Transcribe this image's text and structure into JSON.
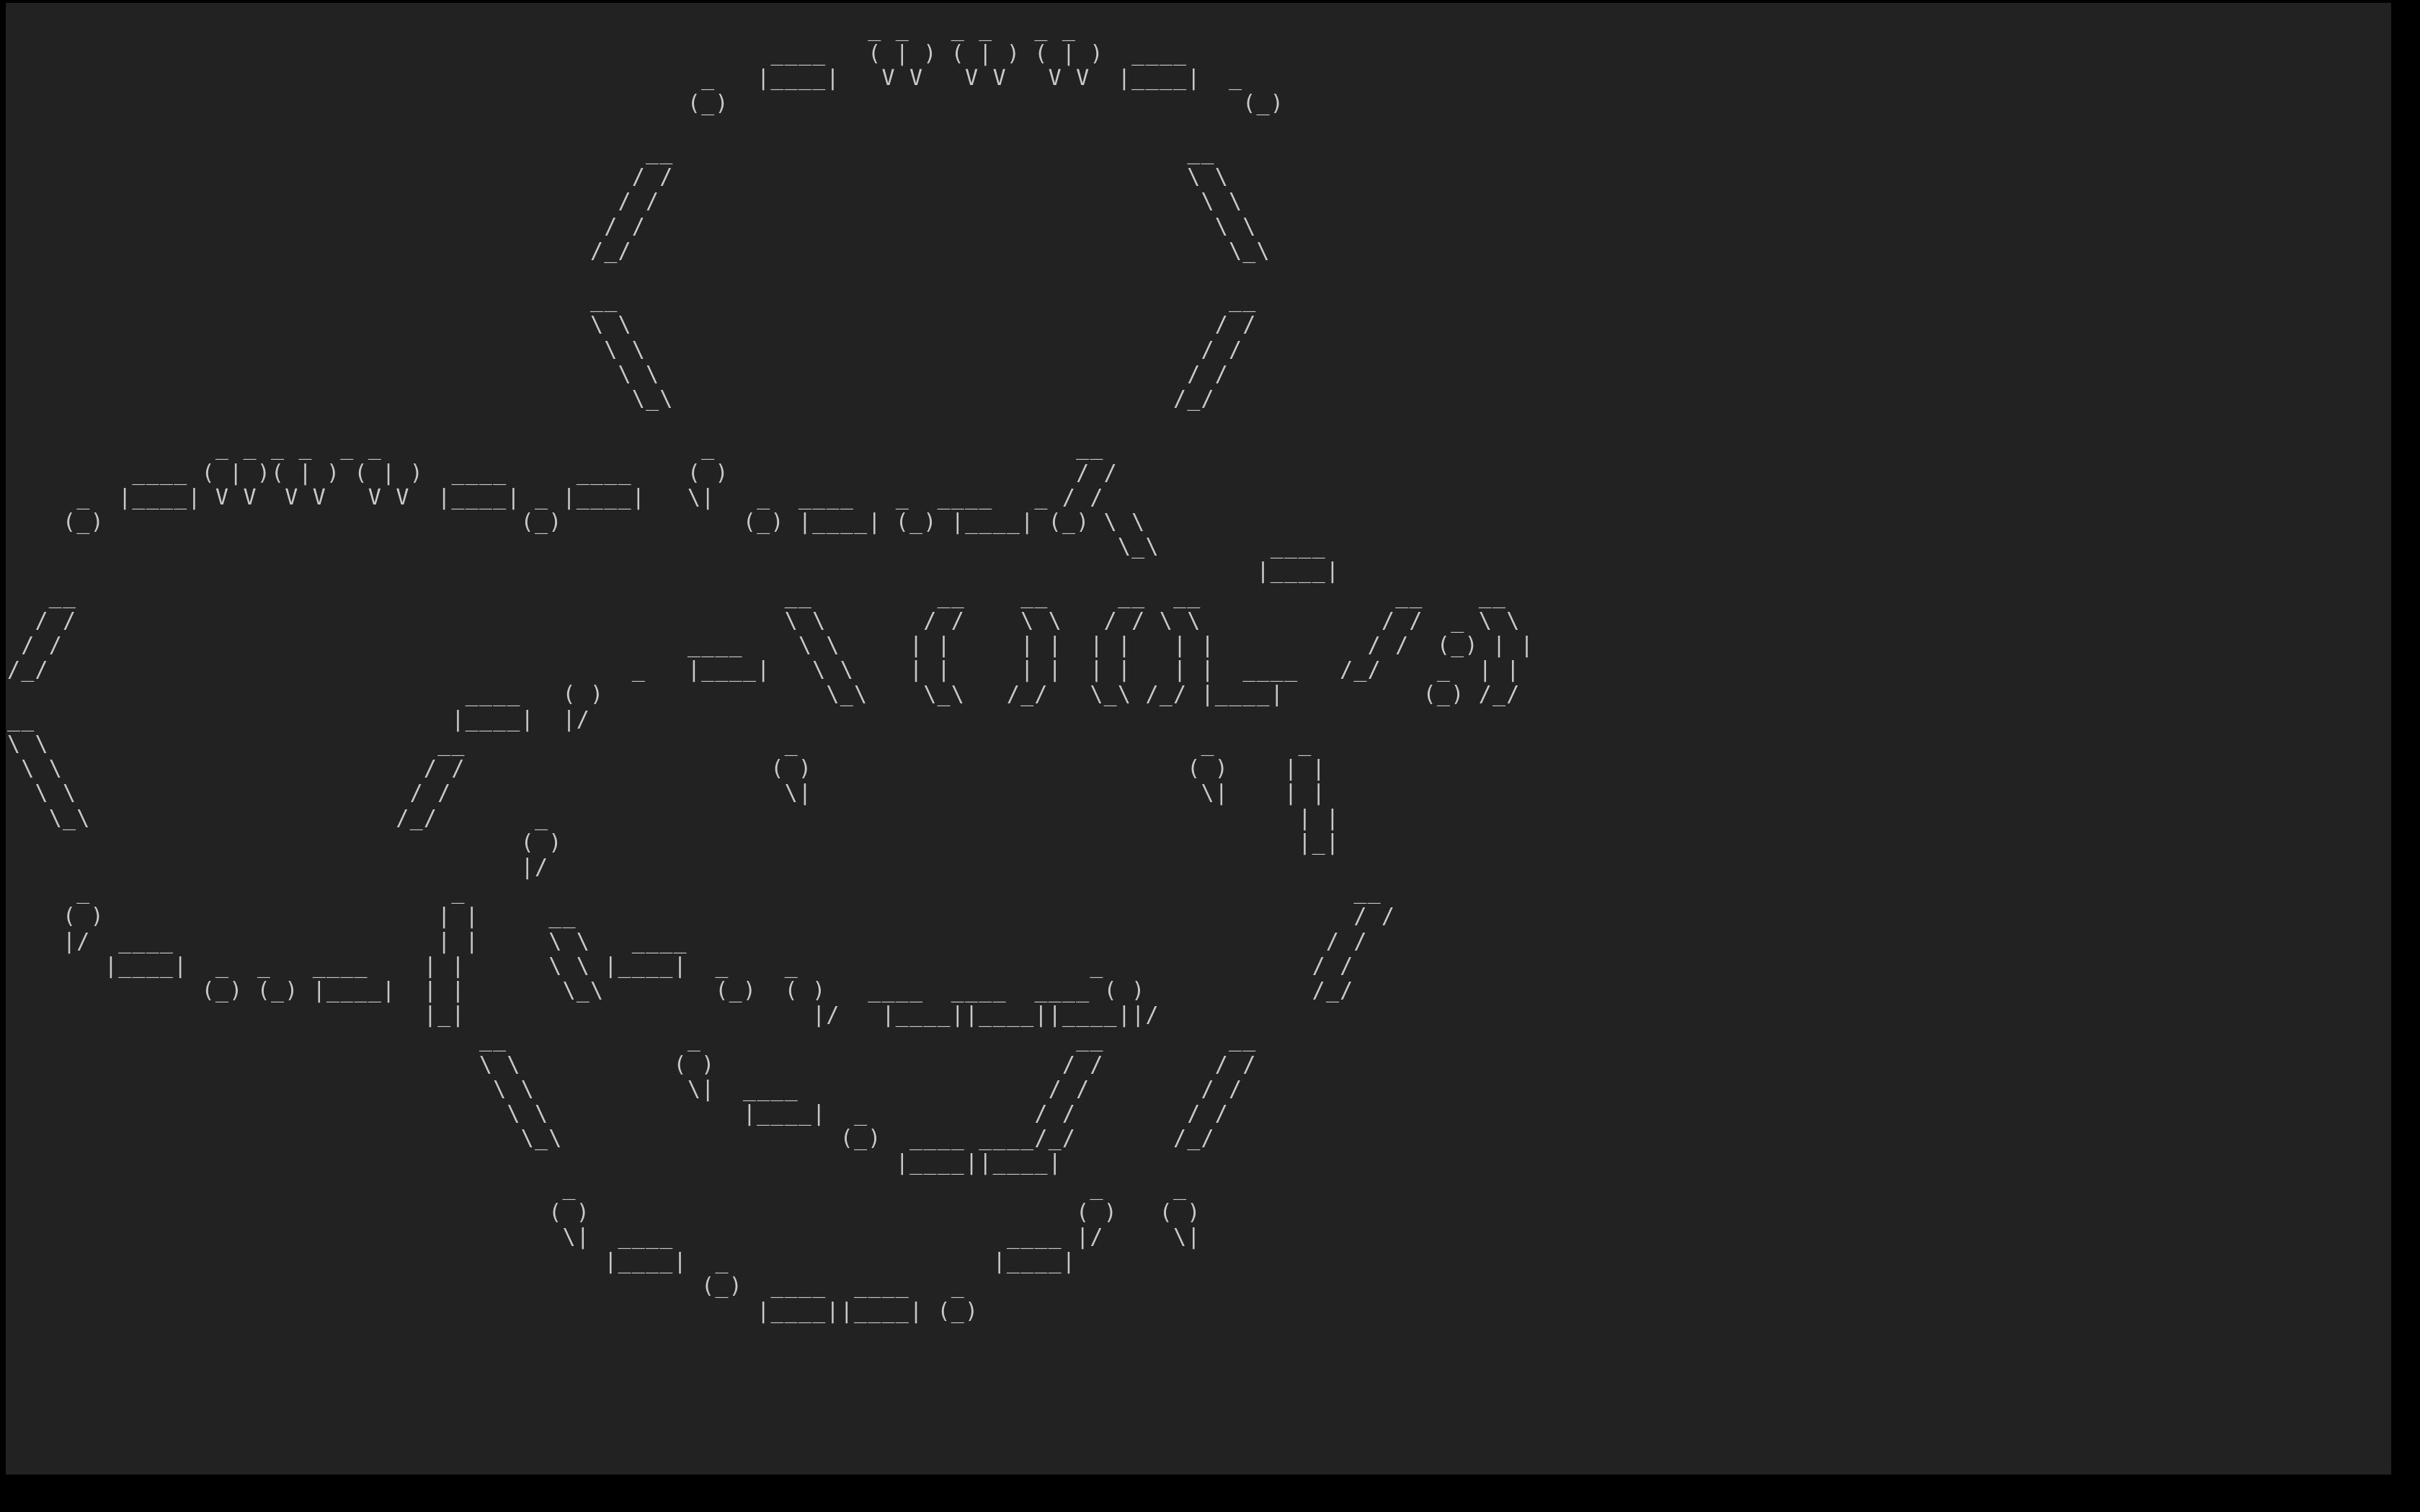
{
  "terminal": {
    "background_color": "#222222",
    "frame_color": "#000000",
    "text_color": "#c9c9c9",
    "lines": [
      "                                                              _ _   _ _   _ _",
      "                                                       ____   ( | ) ( | ) ( | )  ____",
      "                                                  _   |____|   V V   V V   V V  |____|  _",
      "                                                 (_)                                     (_)",
      "",
      "                                              __                                     __",
      "                                             / /                                     \\ \\",
      "                                            / /                                       \\ \\",
      "                                           / /                                         \\ \\",
      "                                          /_/                                           \\_\\",
      "",
      "                                          __                                            __",
      "                                          \\ \\                                          / /",
      "                                           \\ \\                                        / /",
      "                                            \\ \\                                      / /",
      "                                             \\_\\                                    /_/",
      "",
      "               _ _ _ _  _ _                       _                          __",
      "         ____ ( | )( | ) ( | )  ____     ____    ( )                         / /",
      "     _  |____| V V  V V   V V  |____| _ |____|   \\|   _  ____   _  ____   _ / /",
      "    (_)                              (_)             (_) |____| (_) |____| (_) \\ \\",
      "                                                                                \\_\\        ____",
      "                                                                                          |____|",
      "   __                                                   __         __    __     __  __              __    __",
      "  / /                                                   \\ \\       / /    \\ \\   / / \\ \\             / /  _ \\ \\",
      " / /                                             ____    \\ \\     | |     | |  | |   | |           / /  (_) | |",
      "/_/                                          _   |____|   \\ \\    | |     | |  | |   | |  ____   /_/    _  | |",
      "                                 ____   ( )                \\_\\    \\_\\   /_/   \\_\\ /_/ |____|          (_) /_/",
      "__                              |____|  |/",
      "\\ \\                            __                       _                             _      _",
      " \\ \\                          / /                      ( )                           ( )    | |",
      "  \\ \\                        / /                        \\|                            \\|    | |",
      "   \\_\\                      /_/       _                                                      | |",
      "                                     ( )                                                     |_|",
      "                                     |/",
      "     _                          _                                                                __",
      "    ( )                        | |     __                                                        / /",
      "    |/  ____                   | |     \\ \\   ____                                              / /",
      "       |____|  _  _   ____    | |      \\ \\ |____|  _    _                     _               / /",
      "              (_) (_) |____|  | |       \\_\\        (_)  ( )   ____  ____  ____ ( )            /_/",
      "                              |_|                         |/   |____||____||____||/",
      "                                  __             _                           __         __",
      "                                  \\ \\           ( )                         / /        / /",
      "                                   \\ \\           \\|  ____                  / /        / /",
      "                                    \\ \\              |____|  _            / /        / /",
      "                                     \\_\\                    (_)  ____ ____/_/       /_/",
      "                                                                |____||____|",
      "                                        _                                     _     _",
      "                                       ( )                                   ( )   ( )",
      "                                        \\|  ____                        ____ |/     \\|",
      "                                           |____|  _                   |____|",
      "                                                  (_)  ____  ____   _",
      "                                                      |____||____| (_)"
    ]
  }
}
